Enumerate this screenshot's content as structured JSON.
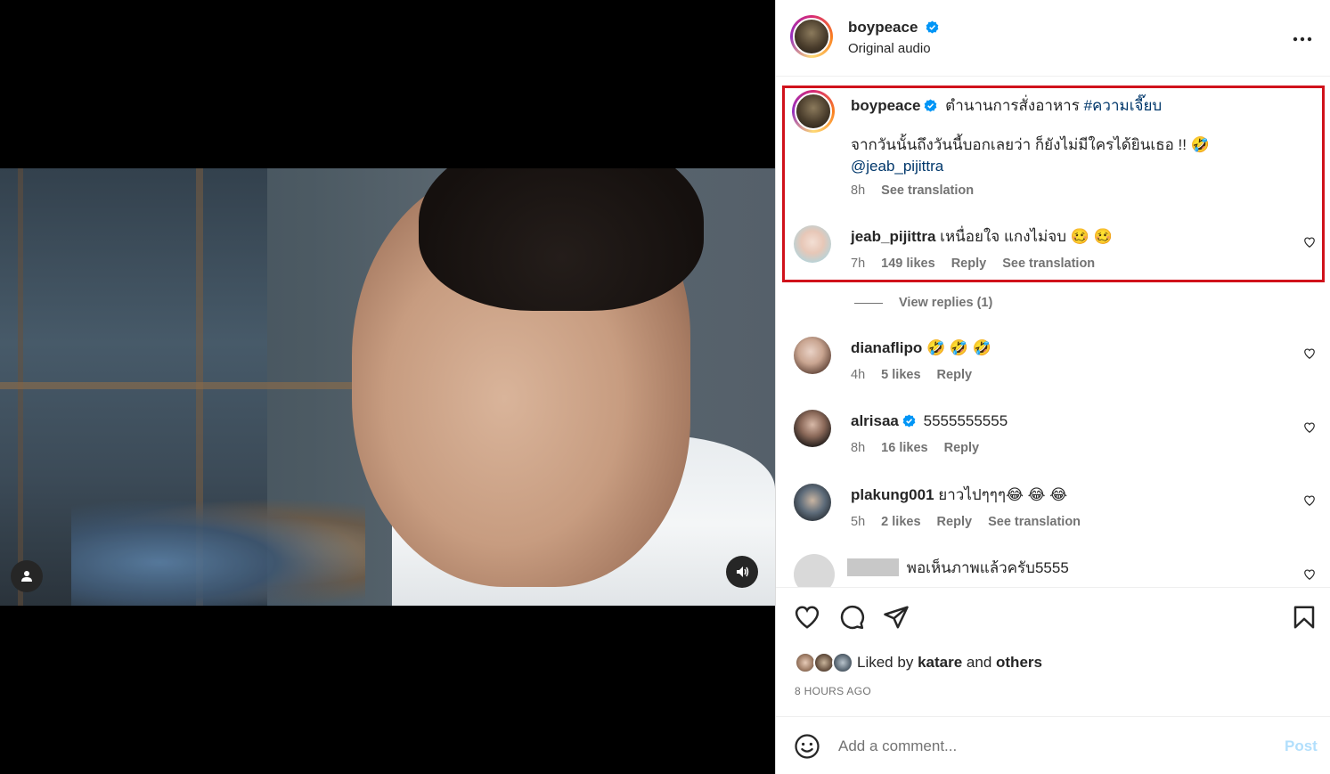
{
  "post": {
    "author": "boypeace",
    "audio": "Original audio",
    "caption_line1": "ตำนานการสั่งอาหาร",
    "caption_hashtag": "#ความเจี๊ยบ",
    "caption_line2": "จากวันนั้นถึงวันนี้บอกเลยว่า ก็ยังไม่มีใครได้ยินเธอ !! 🤣",
    "caption_mention": "@jeab_pijittra",
    "caption_time": "8h",
    "see_translation": "See translation",
    "more_icon": "more-horizontal-icon"
  },
  "comments": [
    {
      "user": "jeab_pijittra",
      "text": "เหนื่อยใจ แกงไม่จบ 🥴 🥴",
      "time": "7h",
      "likes": "149 likes",
      "reply": "Reply",
      "translate": "See translation",
      "view_replies": "View replies (1)"
    },
    {
      "user": "dianaflipo",
      "text": "🤣 🤣 🤣",
      "time": "4h",
      "likes": "5 likes",
      "reply": "Reply"
    },
    {
      "user": "alrisaa",
      "text": "5555555555",
      "time": "8h",
      "likes": "16 likes",
      "reply": "Reply"
    },
    {
      "user": "plakung001",
      "text": "ยาวไปๆๆๆ😂 😂 😂",
      "time": "5h",
      "likes": "2 likes",
      "reply": "Reply",
      "translate": "See translation"
    },
    {
      "user": "",
      "text": "พอเห็นภาพแล้วครับ5555"
    }
  ],
  "actions": {
    "like_icon": "heart-icon",
    "comment_icon": "comment-icon",
    "share_icon": "share-icon",
    "save_icon": "bookmark-icon",
    "liked_by_prefix": "Liked by",
    "liked_by_user": "katare",
    "liked_by_and": "and",
    "liked_by_others": "others",
    "timestamp": "8 HOURS AGO"
  },
  "composer": {
    "placeholder": "Add a comment...",
    "post_label": "Post",
    "emoji_icon": "emoji-icon"
  },
  "colors": {
    "highlight": "#d0121b",
    "link": "#00376b",
    "verified": "#0095f6",
    "post_disabled": "#b2dffc"
  }
}
